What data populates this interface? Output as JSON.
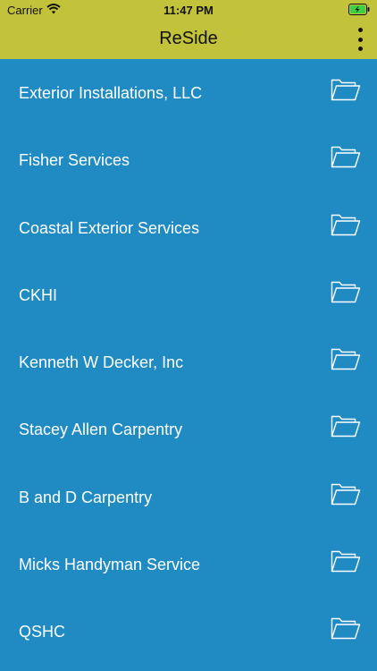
{
  "status": {
    "carrier": "Carrier",
    "time": "11:47 PM",
    "wifi_icon": "wifi-icon",
    "battery_icon": "battery-charging-icon"
  },
  "header": {
    "title": "ReSide",
    "menu_icon": "more-vertical-icon"
  },
  "list": {
    "items": [
      {
        "label": "Exterior Installations, LLC",
        "icon": "folder-icon"
      },
      {
        "label": "Fisher Services",
        "icon": "folder-icon"
      },
      {
        "label": "Coastal Exterior Services",
        "icon": "folder-icon"
      },
      {
        "label": "CKHI",
        "icon": "folder-icon"
      },
      {
        "label": "Kenneth W Decker, Inc",
        "icon": "folder-icon"
      },
      {
        "label": "Stacey Allen Carpentry",
        "icon": "folder-icon"
      },
      {
        "label": "B and D Carpentry",
        "icon": "folder-icon"
      },
      {
        "label": "Micks Handyman Service",
        "icon": "folder-icon"
      },
      {
        "label": "QSHC",
        "icon": "folder-icon"
      }
    ]
  },
  "colors": {
    "header_bg": "#c3c23b",
    "list_bg": "#1f8bc2",
    "text": "#ffffff"
  }
}
